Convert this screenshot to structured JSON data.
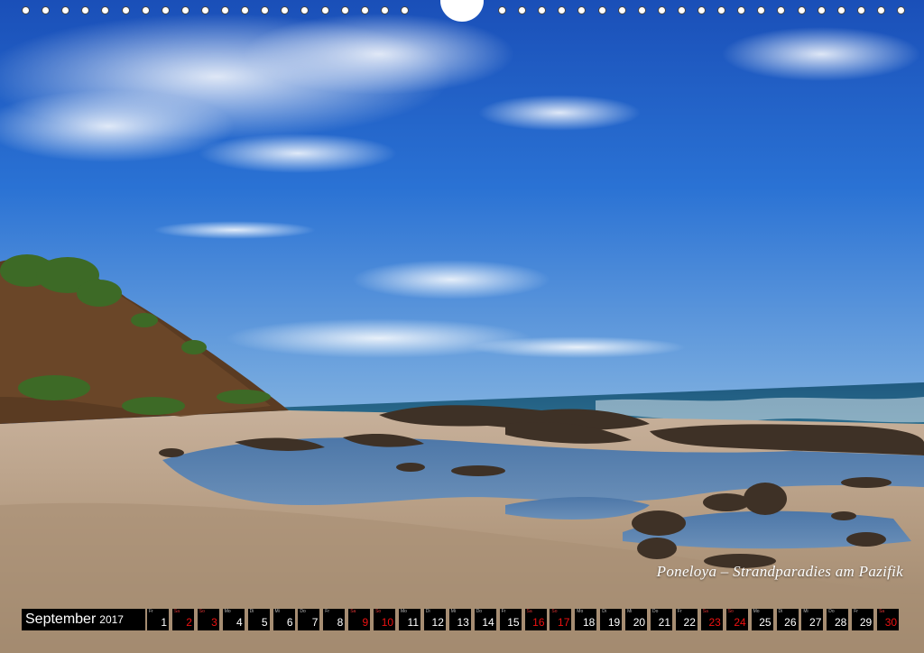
{
  "caption": "Poneloya – Strandparadies am Pazifik",
  "calendar": {
    "month": "September",
    "year": "2017",
    "days": [
      {
        "n": "1",
        "d": "Fr",
        "red": false
      },
      {
        "n": "2",
        "d": "Sa",
        "red": true
      },
      {
        "n": "3",
        "d": "So",
        "red": true
      },
      {
        "n": "4",
        "d": "Mo",
        "red": false
      },
      {
        "n": "5",
        "d": "Di",
        "red": false
      },
      {
        "n": "6",
        "d": "Mi",
        "red": false
      },
      {
        "n": "7",
        "d": "Do",
        "red": false
      },
      {
        "n": "8",
        "d": "Fr",
        "red": false
      },
      {
        "n": "9",
        "d": "Sa",
        "red": true
      },
      {
        "n": "10",
        "d": "So",
        "red": true
      },
      {
        "n": "11",
        "d": "Mo",
        "red": false
      },
      {
        "n": "12",
        "d": "Di",
        "red": false
      },
      {
        "n": "13",
        "d": "Mi",
        "red": false
      },
      {
        "n": "14",
        "d": "Do",
        "red": false
      },
      {
        "n": "15",
        "d": "Fr",
        "red": false
      },
      {
        "n": "16",
        "d": "Sa",
        "red": true
      },
      {
        "n": "17",
        "d": "So",
        "red": true
      },
      {
        "n": "18",
        "d": "Mo",
        "red": false
      },
      {
        "n": "19",
        "d": "Di",
        "red": false
      },
      {
        "n": "20",
        "d": "Mi",
        "red": false
      },
      {
        "n": "21",
        "d": "Do",
        "red": false
      },
      {
        "n": "22",
        "d": "Fr",
        "red": false
      },
      {
        "n": "23",
        "d": "Sa",
        "red": true
      },
      {
        "n": "24",
        "d": "So",
        "red": true
      },
      {
        "n": "25",
        "d": "Mo",
        "red": false
      },
      {
        "n": "26",
        "d": "Di",
        "red": false
      },
      {
        "n": "27",
        "d": "Mi",
        "red": false
      },
      {
        "n": "28",
        "d": "Do",
        "red": false
      },
      {
        "n": "29",
        "d": "Fr",
        "red": false
      },
      {
        "n": "30",
        "d": "Sa",
        "red": true
      }
    ]
  },
  "colors": {
    "sky": "#1d63c8",
    "sea": "#1b4f73",
    "sand": "#b49c83",
    "weekend": "#e11111"
  }
}
